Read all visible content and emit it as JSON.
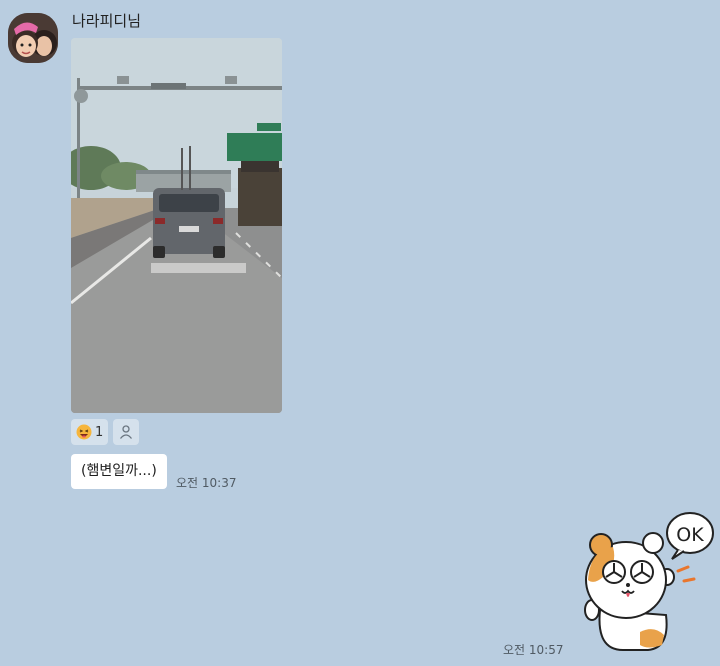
{
  "chat": {
    "sender_name": "나라피디님",
    "reaction": {
      "emoji_icon": "laughing-face-icon",
      "count": "1"
    },
    "message_text": "(햄변일까...)",
    "message_time": "오전 10:37",
    "sticker_icon": "hamster-ok-icon",
    "sticker_text": "OK",
    "sticker_time": "오전 10:57"
  },
  "colors": {
    "background": "#b9cde0",
    "bubble": "#ffffff",
    "reaction_chip": "#d5e1ec"
  }
}
